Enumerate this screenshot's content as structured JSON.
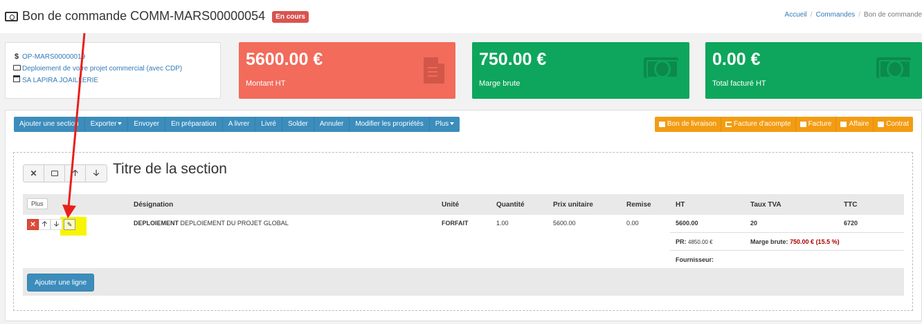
{
  "header": {
    "title": "Bon de commande COMM-MARS00000054",
    "status_badge": "En cours",
    "breadcrumb": [
      "Accueil",
      "Commandes",
      "Bon de commande"
    ]
  },
  "info_card": {
    "opportunity": "OP-MARS00000019",
    "project": "Deploiement de votre projet commercial (avec CDP)",
    "company": "SA LAPIRA JOAILLERIE"
  },
  "kpis": [
    {
      "value": "5600.00 €",
      "label": "Montant HT",
      "color": "#f26b5b"
    },
    {
      "value": "750.00 €",
      "label": "Marge brute",
      "color": "#0ea65c"
    },
    {
      "value": "0.00 €",
      "label": "Total facturé HT",
      "color": "#0ea65c"
    }
  ],
  "toolbar_left": [
    "Ajouter une section",
    "Exporter",
    "Envoyer",
    "En préparation",
    "A livrer",
    "Livré",
    "Solder",
    "Annuler",
    "Modifier les propriétés",
    "Plus"
  ],
  "toolbar_right": [
    "Bon de livraison",
    "Facture d'acompte",
    "Facture",
    "Affaire",
    "Contrat"
  ],
  "section": {
    "title": "Titre de la section",
    "plus_label": "Plus",
    "columns": [
      "Désignation",
      "Unité",
      "Quantité",
      "Prix unitaire",
      "Remise",
      "HT",
      "Taux TVA",
      "TTC"
    ],
    "row": {
      "designation_bold": "DEPLOIEMENT",
      "designation": "DEPLOIEMENT DU PROJET GLOBAL",
      "unit": "FORFAIT",
      "quantity": "1.00",
      "unit_price": "5600.00",
      "discount": "0.00",
      "ht": "5600.00",
      "tva": "20",
      "ttc": "6720"
    },
    "pr_label": "PR:",
    "pr_value": "4850.00 €",
    "margin_label": "Marge brute:",
    "margin_value": "750.00 € (15.5 %)",
    "supplier_label": "Fournisseur:",
    "add_line": "Ajouter une ligne"
  },
  "colors": {
    "primary": "#3c8dbc",
    "orange": "#f39c12",
    "danger": "#dd4b39",
    "highlight": "#f7f500",
    "annotation": "#e8201b"
  }
}
